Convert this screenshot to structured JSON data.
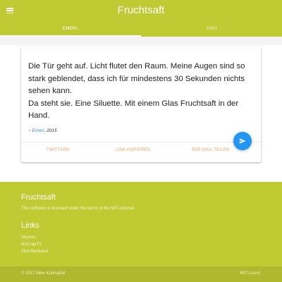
{
  "app": {
    "title": "Fruchtsaft",
    "brand_color": "#c0ca33",
    "menu_icon": "hamburger-menu-icon"
  },
  "tabs": [
    {
      "label": "EMERL",
      "active": true
    },
    {
      "label": "ANNI",
      "active": false
    }
  ],
  "card": {
    "quote_lines": [
      "Die Tür geht auf. Licht flutet den Raum. Meine Augen sind so",
      "stark geblendet, dass ich für mindestens 30 Sekunden nichts",
      "sehen kann.",
      "Da steht sie. Eine Siluette. Mit einem Glas Fruchtsaft in der",
      "Hand."
    ],
    "author_prefix": "~ ",
    "author_name": "Emerl",
    "author_year": ", 2015",
    "actions": {
      "tweet": "TWITTERN",
      "copy_link": "LINK KOPIEREN",
      "email_share": "PER MAIL TEILEN"
    },
    "fab_icon": "send-icon",
    "accent_action_color": "#f0a36a",
    "fab_color": "#2196f3"
  },
  "footer": {
    "title": "Fruchtsaft",
    "license_text": "This software is licensed under the terms of the MIT-License.",
    "links_title": "Links",
    "links": [
      "Veyxos",
      "NoCrapTV",
      "Zitat Backend"
    ],
    "copyright": "© 2017 Mike Kühnapfel",
    "mit_link": "MIT-Lizenz"
  }
}
